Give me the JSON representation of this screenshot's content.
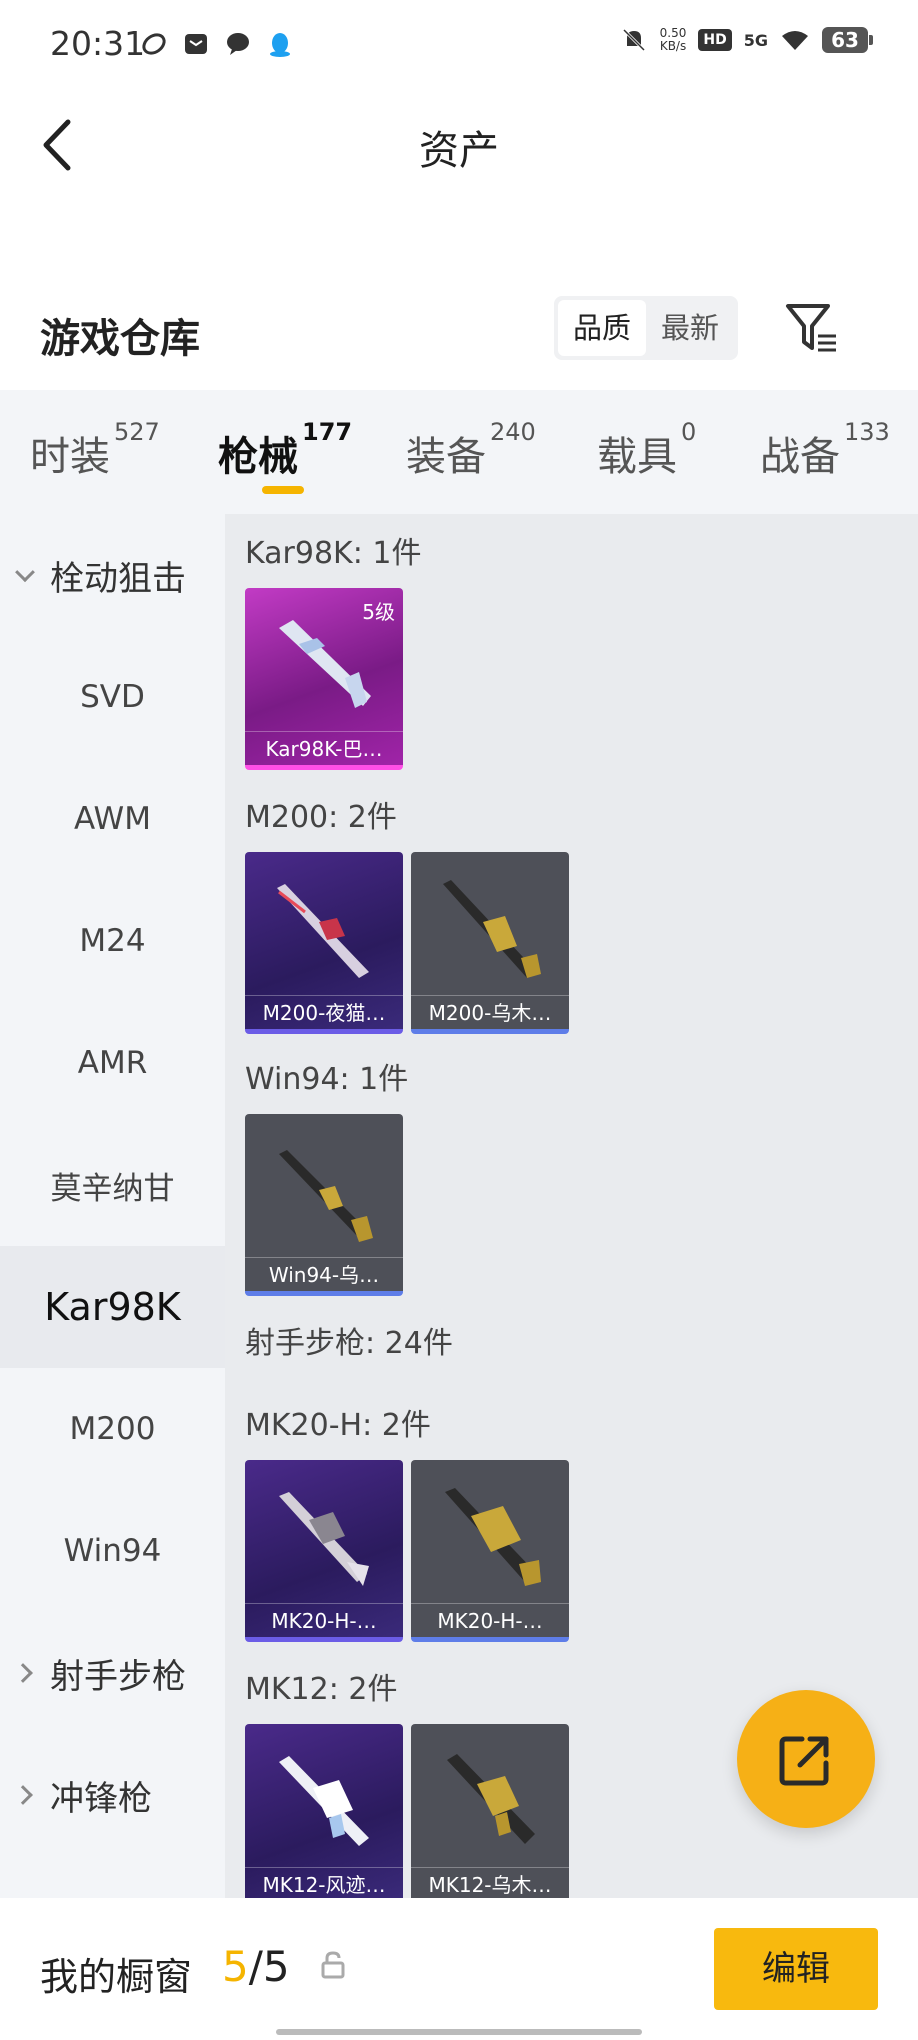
{
  "status": {
    "time": "20:31",
    "net_speed": "0.50",
    "net_unit": "KB/s",
    "hd": "HD",
    "network": "5G",
    "battery": "63"
  },
  "header": {
    "title": "资产"
  },
  "warehouse": {
    "title": "游戏仓库",
    "sort_options": [
      "品质",
      "最新"
    ],
    "active_sort": "品质"
  },
  "tabs": [
    {
      "label": "时装",
      "count": "527"
    },
    {
      "label": "枪械",
      "count": "177"
    },
    {
      "label": "装备",
      "count": "240"
    },
    {
      "label": "载具",
      "count": "0"
    },
    {
      "label": "战备",
      "count": "133"
    }
  ],
  "active_tab": "枪械",
  "sidebar": {
    "items": [
      {
        "label": "栓动狙击",
        "type": "group-expanded"
      },
      {
        "label": "SVD"
      },
      {
        "label": "AWM"
      },
      {
        "label": "M24"
      },
      {
        "label": "AMR"
      },
      {
        "label": "莫辛纳甘"
      },
      {
        "label": "Kar98K",
        "active": true
      },
      {
        "label": "M200"
      },
      {
        "label": "Win94"
      },
      {
        "label": "射手步枪",
        "type": "group-collapsed"
      },
      {
        "label": "冲锋枪",
        "type": "group-collapsed"
      }
    ]
  },
  "sections": [
    {
      "title": "Kar98K: 1件",
      "items": [
        {
          "name": "Kar98K-巴…",
          "level": "5级",
          "rarity": "pink"
        }
      ]
    },
    {
      "title": "M200: 2件",
      "items": [
        {
          "name": "M200-夜猫…",
          "rarity": "purple"
        },
        {
          "name": "M200-乌木…",
          "rarity": "gray"
        }
      ]
    },
    {
      "title": "Win94: 1件",
      "items": [
        {
          "name": "Win94-乌…",
          "rarity": "gray"
        }
      ]
    },
    {
      "title": "射手步枪: 24件",
      "items": []
    },
    {
      "title": "MK20-H: 2件",
      "items": [
        {
          "name": "MK20-H-…",
          "rarity": "purple"
        },
        {
          "name": "MK20-H-…",
          "rarity": "gray"
        }
      ]
    },
    {
      "title": "MK12: 2件",
      "items": [
        {
          "name": "MK12-风迹…",
          "rarity": "purple"
        },
        {
          "name": "MK12-乌木…",
          "rarity": "gray"
        }
      ]
    }
  ],
  "bottom": {
    "showcase_label": "我的橱窗",
    "showcase_current": "5",
    "showcase_separator": "/",
    "showcase_total": "5",
    "edit_label": "编辑"
  },
  "colors": {
    "accent": "#f5b400",
    "edit_button": "#f8b90e",
    "share_button": "#f6b016",
    "rarity_pink": "#ff4fe6",
    "rarity_purple": "#6b5ce6",
    "rarity_gray_bar": "#5e7de8"
  },
  "icons": {
    "back": "chevron-left-icon",
    "filter": "filter-icon",
    "share": "share-icon",
    "lock": "lock-icon"
  }
}
